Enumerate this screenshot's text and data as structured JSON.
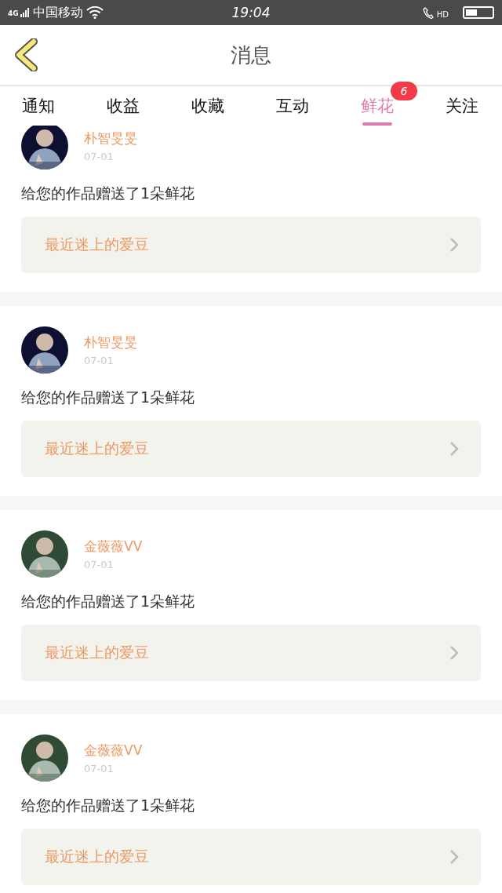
{
  "status_bar": {
    "network": "4G",
    "carrier": "中国移动",
    "time": "19:04",
    "call_label": "HD"
  },
  "header": {
    "title": "消息"
  },
  "tabs": [
    {
      "label": "通知",
      "selected": false
    },
    {
      "label": "收益",
      "selected": false
    },
    {
      "label": "收藏",
      "selected": false
    },
    {
      "label": "互动",
      "selected": false
    },
    {
      "label": "鲜花",
      "selected": true,
      "badge": "6"
    },
    {
      "label": "关注",
      "selected": false
    }
  ],
  "messages": [
    {
      "name": "朴智旻旻",
      "date": "07-01",
      "text": "给您的作品赠送了1朵鲜花",
      "link": "最近迷上的爱豆"
    },
    {
      "name": "朴智旻旻",
      "date": "07-01",
      "text": "给您的作品赠送了1朵鲜花",
      "link": "最近迷上的爱豆"
    },
    {
      "name": "金薇薇VV",
      "date": "07-01",
      "text": "给您的作品赠送了1朵鲜花",
      "link": "最近迷上的爱豆"
    },
    {
      "name": "金薇薇VV",
      "date": "07-01",
      "text": "给您的作品赠送了1朵鲜花",
      "link": "最近迷上的爱豆"
    }
  ]
}
